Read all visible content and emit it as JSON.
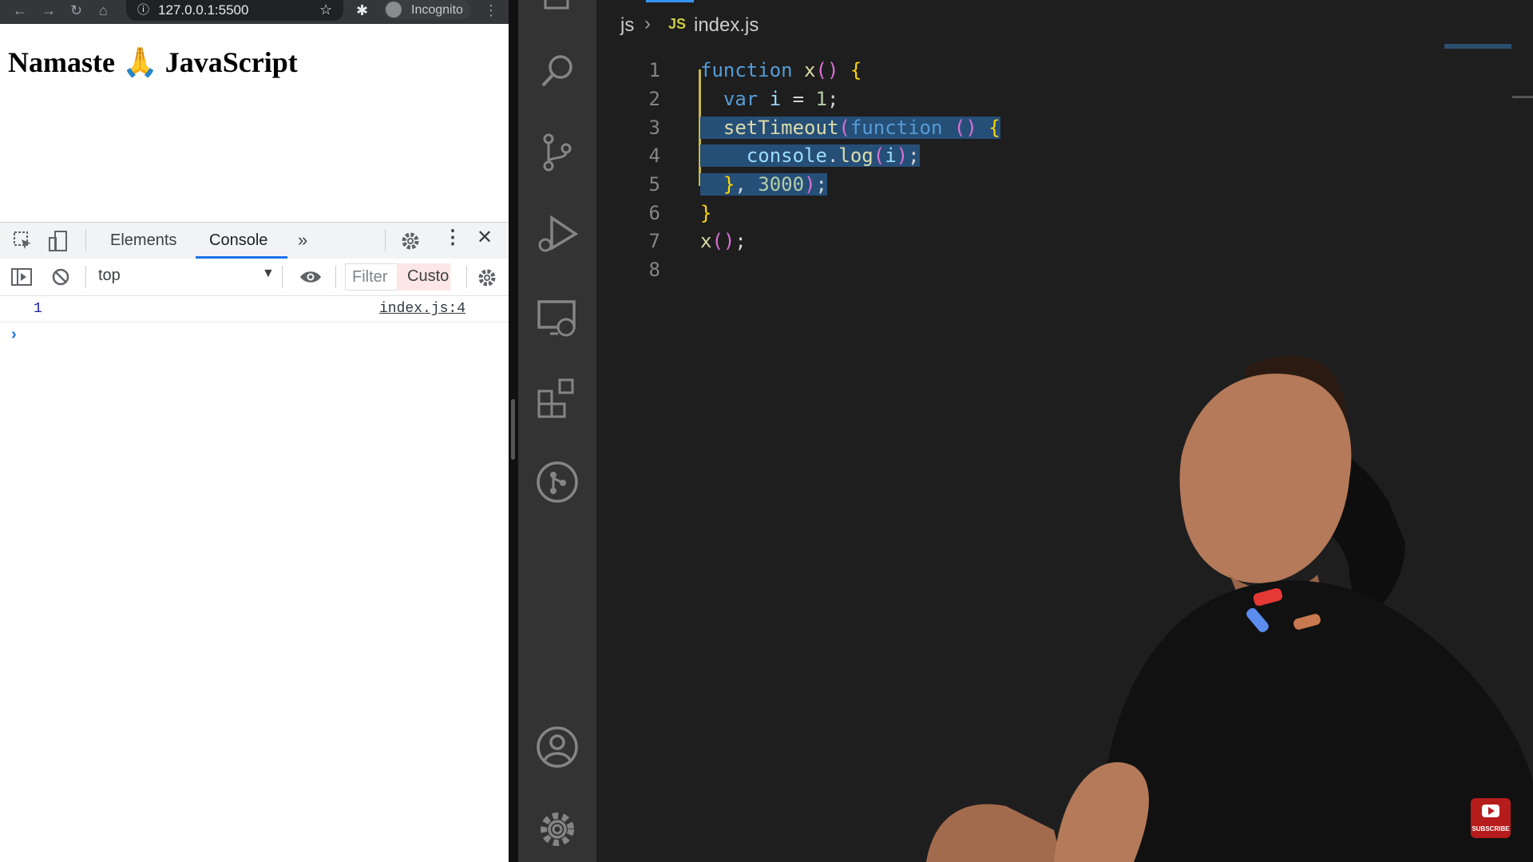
{
  "browser": {
    "url": "127.0.0.1:5500",
    "incognito_label": "Incognito",
    "page_heading": "Namaste 🙏 JavaScript",
    "devtools": {
      "tabs": [
        "Elements",
        "Console"
      ],
      "active_tab": "Console",
      "context": "top",
      "filter_placeholder": "Filter",
      "custom_levels_label": "Custo",
      "console_output": {
        "value": "1",
        "source": "index.js:4"
      },
      "prompt_symbol": "›"
    }
  },
  "editor": {
    "breadcrumb": {
      "folder": "js",
      "badge": "JS",
      "file": "index.js"
    },
    "line_numbers": [
      "1",
      "2",
      "3",
      "4",
      "5",
      "6",
      "7",
      "8"
    ],
    "lines": [
      "function x() {",
      "  var i = 1;",
      "  setTimeout(function () {",
      "    console.log(i);",
      "  }, 3000);",
      "}",
      "x();",
      ""
    ]
  },
  "icons": {
    "activity_bar": [
      "files-icon",
      "search-icon",
      "source-control-icon",
      "run-debug-icon",
      "remote-explorer-icon",
      "extensions-icon",
      "git-graph-icon",
      "account-icon",
      "settings-gear-icon"
    ]
  },
  "subscribe_badge_text": "SUBSCRIBE",
  "colors": {
    "keyword": "#569cd6",
    "function": "#dcdcaa",
    "bracket_gold": "#ffd700",
    "bracket_purple": "#da70d6",
    "number": "#b5cea8",
    "selection": "#264f78",
    "active_tab_blue": "#1a73e8"
  }
}
